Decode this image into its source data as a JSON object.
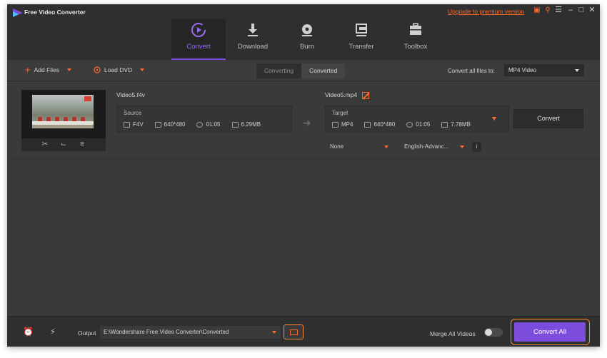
{
  "titlebar": {
    "app_title": "Free Video Converter",
    "upgrade_link": "Upgrade to premium version",
    "icons": [
      "gift-icon",
      "key-icon",
      "menu-icon",
      "minimize-icon",
      "maximize-icon",
      "close-icon"
    ]
  },
  "nav": {
    "items": [
      {
        "label": "Convert",
        "icon": "convert-icon",
        "active": true
      },
      {
        "label": "Download",
        "icon": "download-icon",
        "active": false
      },
      {
        "label": "Burn",
        "icon": "burn-icon",
        "active": false
      },
      {
        "label": "Transfer",
        "icon": "transfer-icon",
        "active": false
      },
      {
        "label": "Toolbox",
        "icon": "toolbox-icon",
        "active": false
      }
    ]
  },
  "toolbar": {
    "add_files": "Add Files",
    "load_dvd": "Load DVD",
    "tab_converting": "Converting",
    "tab_converted": "Converted",
    "convert_all_to_label": "Convert all files to:",
    "convert_all_to_value": "MP4 Video"
  },
  "file": {
    "source_name": "Video5.f4v",
    "source": {
      "title": "Source",
      "format": "F4V",
      "resolution": "640*480",
      "duration": "01:05",
      "size": "6.29MB"
    },
    "target_name": "Video5.mp4",
    "target": {
      "title": "Target",
      "format": "MP4",
      "resolution": "640*480",
      "duration": "01:05",
      "size": "7.78MB"
    },
    "subtitle": "None",
    "audio": "English-Advanc...",
    "convert_button": "Convert"
  },
  "bottom": {
    "output_label": "Output",
    "output_path": "E:\\Wondershare Free Video Converter\\Converted",
    "merge_label": "Merge All Videos",
    "merge_on": false,
    "convert_all": "Convert All"
  },
  "colors": {
    "accent": "#7c4ddc",
    "orange": "#ff6a2b",
    "background": "#3a3a3a"
  }
}
